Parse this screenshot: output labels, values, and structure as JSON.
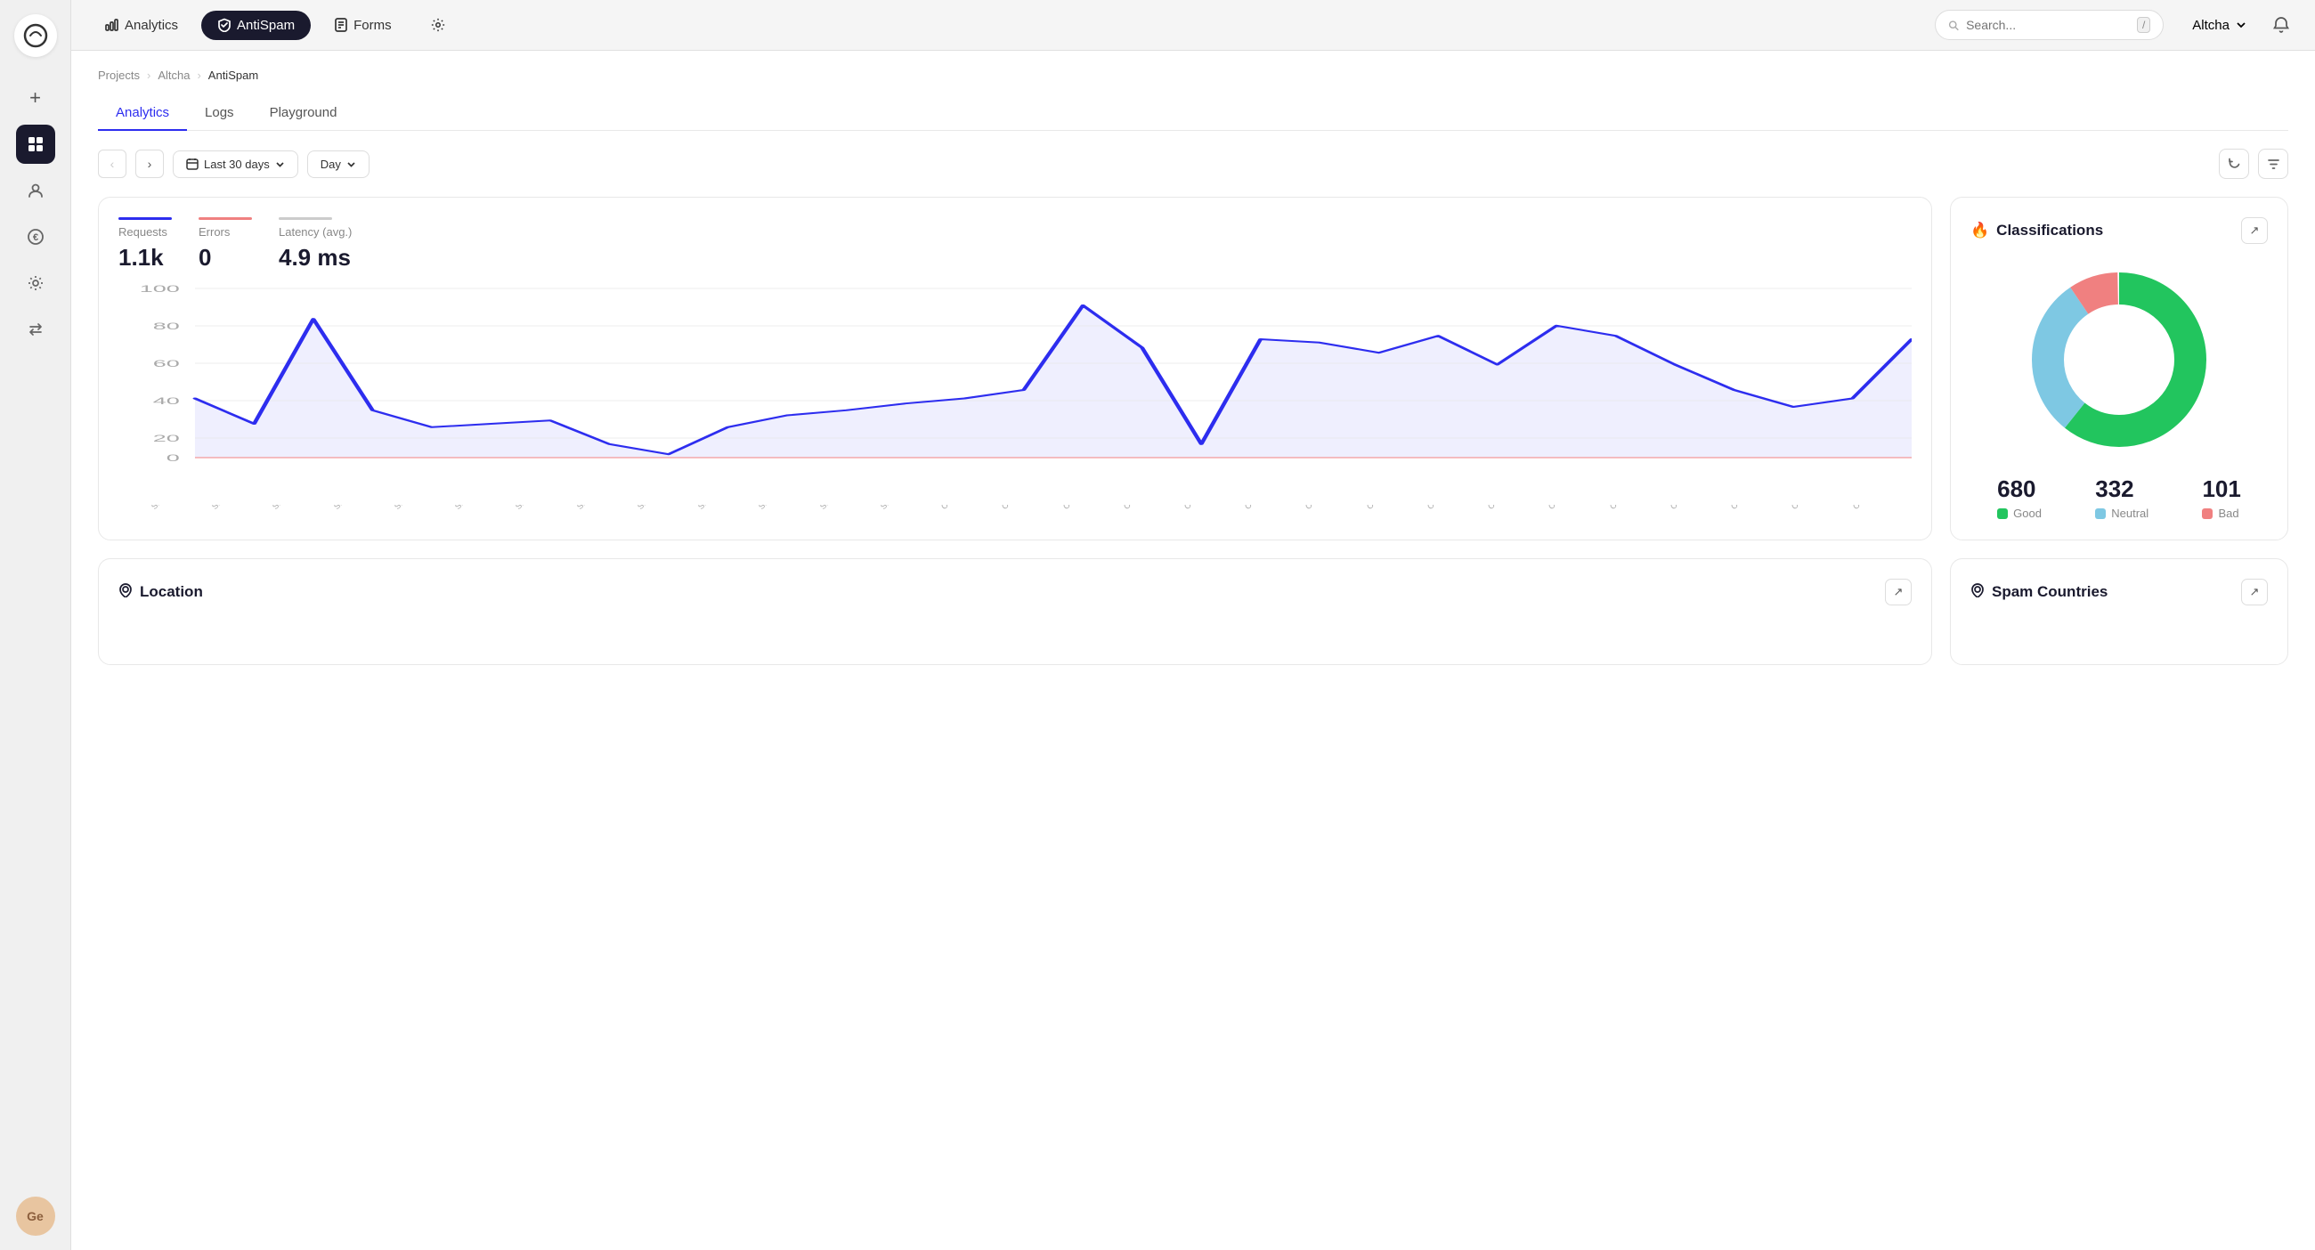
{
  "app": {
    "logo_text": "◎"
  },
  "sidebar": {
    "add_label": "+",
    "avatar_label": "Ge",
    "items": [
      {
        "id": "grid",
        "icon": "⊞",
        "active": true
      },
      {
        "id": "users",
        "icon": "👤",
        "active": false
      },
      {
        "id": "billing",
        "icon": "€",
        "active": false
      },
      {
        "id": "settings",
        "icon": "⚙",
        "active": false
      },
      {
        "id": "transfers",
        "icon": "⇄",
        "active": false
      }
    ]
  },
  "topnav": {
    "tabs": [
      {
        "id": "analytics",
        "label": "Analytics",
        "icon": "chart",
        "active": false
      },
      {
        "id": "antispam",
        "label": "AntiSpam",
        "icon": "shield",
        "active": true
      },
      {
        "id": "forms",
        "label": "Forms",
        "icon": "doc",
        "active": false
      },
      {
        "id": "settings",
        "label": "",
        "icon": "gear",
        "active": false
      }
    ],
    "search_placeholder": "Search...",
    "kbd_hint": "/",
    "user_name": "Altcha",
    "bell_icon": "🔔"
  },
  "breadcrumb": {
    "items": [
      "Projects",
      "Altcha",
      "AntiSpam"
    ]
  },
  "page_tabs": [
    {
      "id": "analytics",
      "label": "Analytics",
      "active": true
    },
    {
      "id": "logs",
      "label": "Logs",
      "active": false
    },
    {
      "id": "playground",
      "label": "Playground",
      "active": false
    }
  ],
  "filters": {
    "prev_label": "‹",
    "next_label": "›",
    "date_range": "Last 30 days",
    "granularity": "Day",
    "refresh_icon": "↻",
    "filter_icon": "⊟"
  },
  "chart": {
    "title": "Requests",
    "legend": [
      {
        "id": "requests",
        "label": "Requests",
        "value": "1.1k",
        "color": "#2d2def"
      },
      {
        "id": "errors",
        "label": "Errors",
        "value": "0",
        "color": "#f08080"
      },
      {
        "id": "latency",
        "label": "Latency (avg.)",
        "value": "4.9 ms",
        "color": "#cccccc"
      }
    ],
    "y_labels": [
      "100",
      "80",
      "60",
      "40",
      "20",
      "0"
    ],
    "x_labels": [
      "Sep 18",
      "Sep 19",
      "Sep 20",
      "Sep 21",
      "Sep 22",
      "Sep 23",
      "Sep 24",
      "Sep 25",
      "Sep 26",
      "Sep 27",
      "Sep 28",
      "Sep 29",
      "Sep 30",
      "Oct 1",
      "Oct 2",
      "Oct 3",
      "Oct 4",
      "Oct 5",
      "Oct 6",
      "Oct 7",
      "Oct 8",
      "Oct 9",
      "Oct 10",
      "Oct 11",
      "Oct 12",
      "Oct 13",
      "Oct 14",
      "Oct 15",
      "Oct 16",
      "Oct 17"
    ],
    "data_points": [
      35,
      20,
      82,
      28,
      18,
      20,
      22,
      8,
      2,
      18,
      25,
      28,
      32,
      35,
      40,
      90,
      65,
      8,
      70,
      68,
      62,
      72,
      55,
      78,
      72,
      55,
      40,
      30,
      35,
      70
    ]
  },
  "classifications": {
    "title": "Classifications",
    "fire_icon": "🔥",
    "expand_icon": "↗",
    "stats": [
      {
        "id": "good",
        "value": "680",
        "label": "Good",
        "color": "#22c55e"
      },
      {
        "id": "neutral",
        "value": "332",
        "label": "Neutral",
        "color": "#7ec8e3"
      },
      {
        "id": "bad",
        "value": "101",
        "label": "Bad",
        "color": "#f08080"
      }
    ],
    "donut": {
      "good_pct": 61,
      "neutral_pct": 30,
      "bad_pct": 9
    }
  },
  "bottom_cards": [
    {
      "id": "location",
      "title": "Location",
      "icon": "📍",
      "expand_icon": "↗"
    },
    {
      "id": "spam_countries",
      "title": "Spam Countries",
      "icon": "📍",
      "expand_icon": "↗"
    }
  ]
}
